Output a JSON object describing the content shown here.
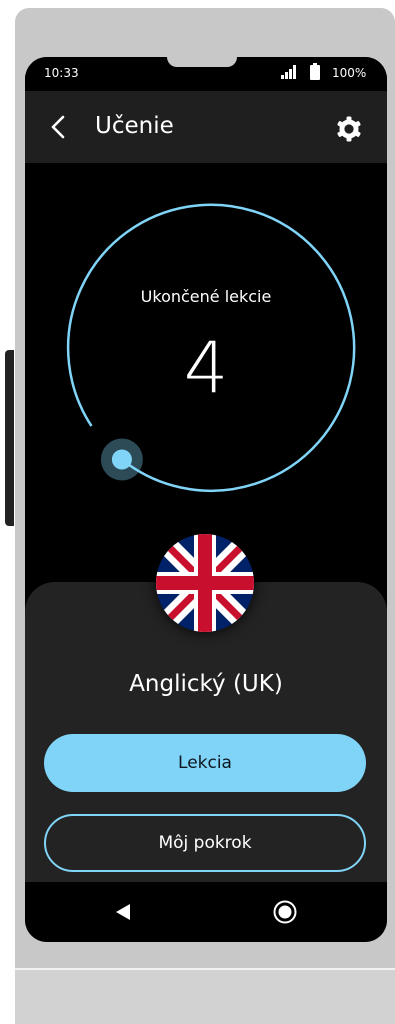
{
  "status_bar": {
    "time": "10:33",
    "battery": "100%"
  },
  "header": {
    "title": "Učenie",
    "back_icon": "chevron-left-icon",
    "settings_icon": "gear-icon"
  },
  "progress": {
    "label": "Ukončené lekcie",
    "count": "4",
    "ring_color": "#80d4f8"
  },
  "language": {
    "name": "Anglický (UK)",
    "flag_icon": "uk-flag-icon"
  },
  "actions": {
    "lesson_label": "Lekcia",
    "my_progress_label": "Môj pokrok"
  },
  "nav": {
    "back_icon": "triangle-back-icon",
    "home_icon": "home-circle-icon"
  },
  "colors": {
    "accent": "#80d4f8",
    "app_bar": "#1f1f1f",
    "sheet": "#232323",
    "background": "#000000"
  }
}
